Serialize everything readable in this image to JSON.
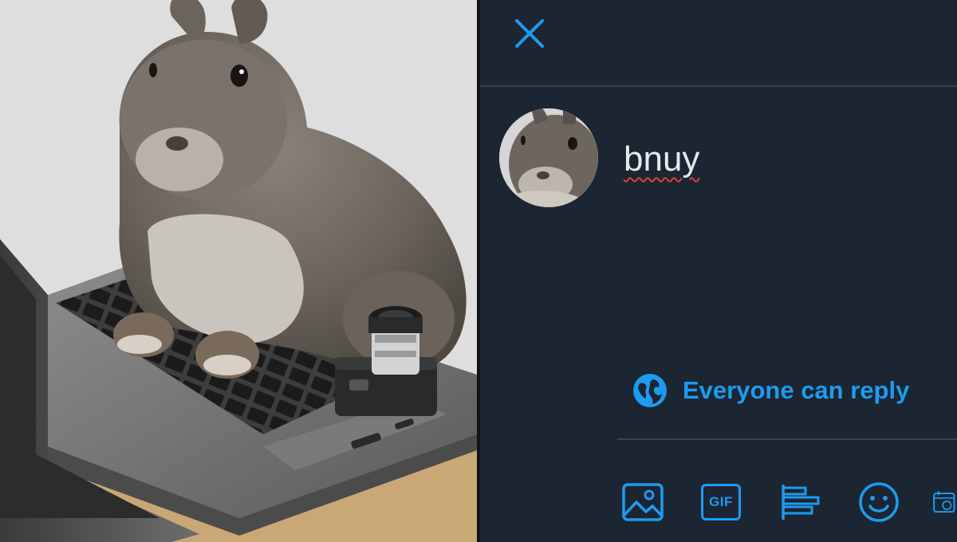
{
  "compose": {
    "tweet_text": "bnuy",
    "reply_setting": "Everyone can reply",
    "gif_label": "GIF"
  },
  "colors": {
    "accent": "#1d9bf0",
    "panel_background": "#1c2532",
    "divider": "#38444d",
    "text": "#e7e9ea",
    "spellcheck_underline": "#d9433b"
  },
  "icons": {
    "close": "close-icon",
    "globe": "globe-icon",
    "image": "image-icon",
    "gif": "gif-icon",
    "poll": "poll-icon",
    "emoji": "emoji-icon",
    "schedule": "schedule-icon"
  }
}
